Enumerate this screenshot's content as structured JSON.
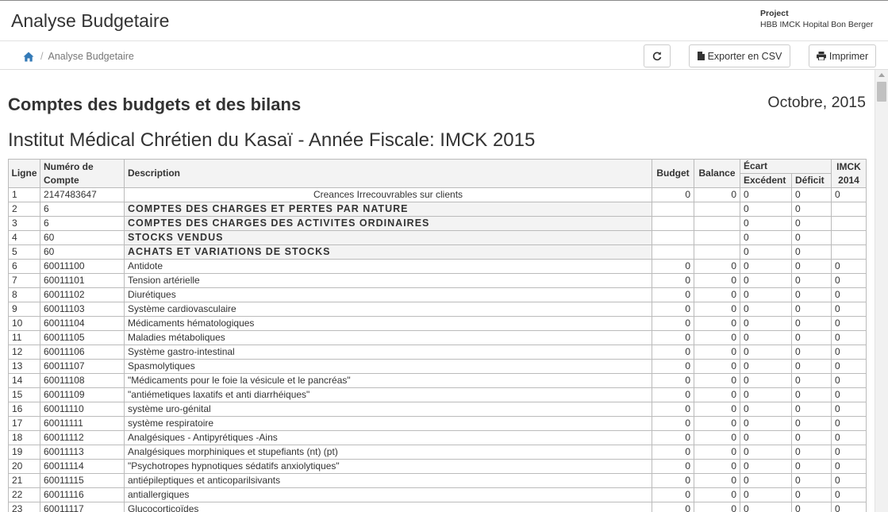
{
  "header": {
    "title": "Analyse Budgetaire",
    "project_label": "Project",
    "project_name": "HBB IMCK Hopital Bon Berger"
  },
  "toolbar": {
    "breadcrumb_home_icon": "home-icon",
    "breadcrumb_current": "Analyse Budgetaire",
    "refresh_icon": "refresh-icon",
    "export_label": "Exporter en CSV",
    "print_label": "Imprimer"
  },
  "report": {
    "heading": "Comptes des budgets et des bilans",
    "date": "Octobre, 2015",
    "subtitle": "Institut Médical Chrétien du Kasaï - Année Fiscale: IMCK 2015"
  },
  "table": {
    "headers": {
      "ligne": "Ligne",
      "numero": "Numéro de Compte",
      "description": "Description",
      "budget": "Budget",
      "balance": "Balance",
      "ecart": "Écart",
      "excedent": "Excédent",
      "deficit": "Déficit",
      "imck": "IMCK 2014"
    },
    "rows": [
      {
        "ligne": "1",
        "compte": "2147483647",
        "description": "Creances Irrecouvrables sur clients",
        "style": "center",
        "budget": "0",
        "balance": "0",
        "excedent": "0",
        "deficit": "0",
        "imck": "0"
      },
      {
        "ligne": "2",
        "compte": "6",
        "description": "COMPTES DES CHARGES ET PERTES PAR NATURE",
        "style": "header",
        "budget": "",
        "balance": "",
        "excedent": "0",
        "deficit": "0",
        "imck": ""
      },
      {
        "ligne": "3",
        "compte": "6",
        "description": "COMPTES DES CHARGES DES ACTIVITES ORDINAIRES",
        "style": "header",
        "budget": "",
        "balance": "",
        "excedent": "0",
        "deficit": "0",
        "imck": ""
      },
      {
        "ligne": "4",
        "compte": "60",
        "description": "STOCKS VENDUS",
        "style": "header2",
        "budget": "",
        "balance": "",
        "excedent": "0",
        "deficit": "0",
        "imck": ""
      },
      {
        "ligne": "5",
        "compte": "60",
        "description": "ACHATS ET VARIATIONS DE STOCKS",
        "style": "header2",
        "budget": "",
        "balance": "",
        "excedent": "0",
        "deficit": "0",
        "imck": ""
      },
      {
        "ligne": "6",
        "compte": "60011100",
        "description": "Antidote",
        "style": "indent",
        "budget": "0",
        "balance": "0",
        "excedent": "0",
        "deficit": "0",
        "imck": "0"
      },
      {
        "ligne": "7",
        "compte": "60011101",
        "description": "Tension artérielle",
        "style": "indent",
        "budget": "0",
        "balance": "0",
        "excedent": "0",
        "deficit": "0",
        "imck": "0"
      },
      {
        "ligne": "8",
        "compte": "60011102",
        "description": "Diurétiques",
        "style": "indent",
        "budget": "0",
        "balance": "0",
        "excedent": "0",
        "deficit": "0",
        "imck": "0"
      },
      {
        "ligne": "9",
        "compte": "60011103",
        "description": "Système cardiovasculaire",
        "style": "indent",
        "budget": "0",
        "balance": "0",
        "excedent": "0",
        "deficit": "0",
        "imck": "0"
      },
      {
        "ligne": "10",
        "compte": "60011104",
        "description": "Médicaments hématologiques",
        "style": "indent",
        "budget": "0",
        "balance": "0",
        "excedent": "0",
        "deficit": "0",
        "imck": "0"
      },
      {
        "ligne": "11",
        "compte": "60011105",
        "description": "Maladies métaboliques",
        "style": "indent",
        "budget": "0",
        "balance": "0",
        "excedent": "0",
        "deficit": "0",
        "imck": "0"
      },
      {
        "ligne": "12",
        "compte": "60011106",
        "description": "Système gastro-intestinal",
        "style": "indent",
        "budget": "0",
        "balance": "0",
        "excedent": "0",
        "deficit": "0",
        "imck": "0"
      },
      {
        "ligne": "13",
        "compte": "60011107",
        "description": "Spasmolytiques",
        "style": "indent",
        "budget": "0",
        "balance": "0",
        "excedent": "0",
        "deficit": "0",
        "imck": "0"
      },
      {
        "ligne": "14",
        "compte": "60011108",
        "description": "\"Médicaments pour le foie la vésicule et le pancréas\"",
        "style": "indent",
        "budget": "0",
        "balance": "0",
        "excedent": "0",
        "deficit": "0",
        "imck": "0"
      },
      {
        "ligne": "15",
        "compte": "60011109",
        "description": "\"antiémetiques laxatifs et anti diarrhéiques\"",
        "style": "indent",
        "budget": "0",
        "balance": "0",
        "excedent": "0",
        "deficit": "0",
        "imck": "0"
      },
      {
        "ligne": "16",
        "compte": "60011110",
        "description": "système uro-génital",
        "style": "indent",
        "budget": "0",
        "balance": "0",
        "excedent": "0",
        "deficit": "0",
        "imck": "0"
      },
      {
        "ligne": "17",
        "compte": "60011111",
        "description": "système respiratoire",
        "style": "indent",
        "budget": "0",
        "balance": "0",
        "excedent": "0",
        "deficit": "0",
        "imck": "0"
      },
      {
        "ligne": "18",
        "compte": "60011112",
        "description": "Analgésiques - Antipyrétiques -Ains",
        "style": "indent",
        "budget": "0",
        "balance": "0",
        "excedent": "0",
        "deficit": "0",
        "imck": "0"
      },
      {
        "ligne": "19",
        "compte": "60011113",
        "description": "Analgésiques morphiniques et stupefiants (nt) (pt)",
        "style": "indent",
        "budget": "0",
        "balance": "0",
        "excedent": "0",
        "deficit": "0",
        "imck": "0"
      },
      {
        "ligne": "20",
        "compte": "60011114",
        "description": "\"Psychotropes hypnotiques sédatifs anxiolytiques\"",
        "style": "indent",
        "budget": "0",
        "balance": "0",
        "excedent": "0",
        "deficit": "0",
        "imck": "0"
      },
      {
        "ligne": "21",
        "compte": "60011115",
        "description": "antiépileptiques et anticoparilsivants",
        "style": "indent",
        "budget": "0",
        "balance": "0",
        "excedent": "0",
        "deficit": "0",
        "imck": "0"
      },
      {
        "ligne": "22",
        "compte": "60011116",
        "description": "antiallergiques",
        "style": "indent",
        "budget": "0",
        "balance": "0",
        "excedent": "0",
        "deficit": "0",
        "imck": "0"
      },
      {
        "ligne": "23",
        "compte": "60011117",
        "description": "Glucocorticoïdes",
        "style": "indent",
        "budget": "0",
        "balance": "0",
        "excedent": "0",
        "deficit": "0",
        "imck": "0"
      }
    ]
  }
}
